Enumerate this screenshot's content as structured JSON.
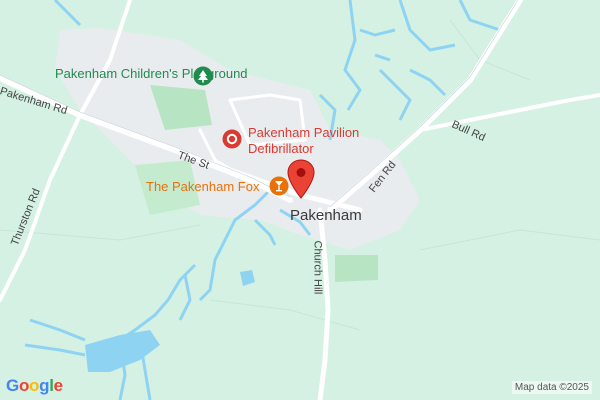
{
  "map": {
    "labels": {
      "playground": "Pakenham Children's Playground",
      "pavilion_line1": "Pakenham Pavilion",
      "pavilion_line2": "Defibrillator",
      "fox": "The Pakenham Fox",
      "town": "Pakenham",
      "pakenham_rd": "Pakenham Rd",
      "the_st": "The St",
      "thurston_rd": "Thurston Rd",
      "church_hill": "Church Hill",
      "fen_rd": "Fen Rd",
      "bull_rd": "Bull Rd"
    },
    "attribution": "Map data ©2025",
    "logo_letters": [
      "G",
      "o",
      "o",
      "g",
      "l",
      "e"
    ],
    "icons": {
      "playground": "tree-icon",
      "pavilion": "medical-plus-icon",
      "fox": "cocktail-glass-icon",
      "marker": "red-location-pin-icon"
    },
    "colors": {
      "land": "#d4f1e3",
      "built_up": "#e9ecef",
      "park": "#b7e5c4",
      "water": "#8fd3f3",
      "road": "#ffffff",
      "marker": "#ea4335",
      "logo": [
        "#4285f4",
        "#ea4335",
        "#fbbc05",
        "#4285f4",
        "#34a853",
        "#ea4335"
      ]
    }
  }
}
